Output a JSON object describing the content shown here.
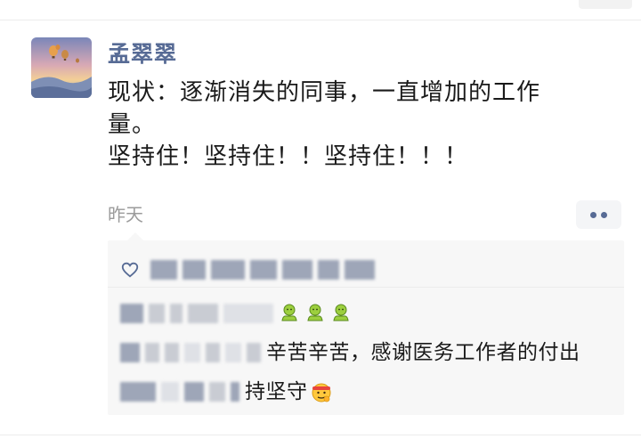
{
  "moment": {
    "username": "孟翠翠",
    "text_lines": [
      "现状：逐渐消失的同事，一直增加的工作",
      "量。",
      "坚持住！坚持住！！坚持住！！！"
    ],
    "timestamp": "昨天"
  },
  "icons": {
    "more": "more-dots-icon",
    "like": "heart-outline-icon",
    "green_emoji": "muscle-green-emoji",
    "hard_work_emoji": "headband-face-emoji",
    "avatar_scene": "hot-air-balloons-sunset"
  },
  "comments": [
    {
      "visible_text": ""
    },
    {
      "visible_text": "辛苦辛苦，感谢医务工作者的付出"
    },
    {
      "visible_text": "持坚守"
    }
  ],
  "colors": {
    "name_link": "#576b95",
    "timestamp": "#9b9b9b",
    "comment_bg": "#f7f7f7"
  }
}
